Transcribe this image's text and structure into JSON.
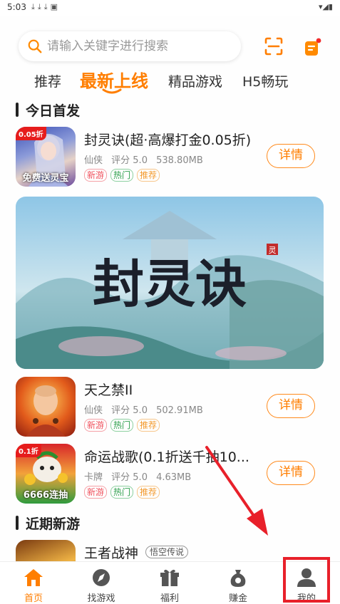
{
  "status_bar": {
    "time": "5:03"
  },
  "search": {
    "placeholder": "请输入关键字进行搜索"
  },
  "tabs": [
    {
      "label": "推荐",
      "active": false
    },
    {
      "label": "最新上线",
      "active": true
    },
    {
      "label": "精品游戏",
      "active": false
    },
    {
      "label": "H5畅玩",
      "active": false
    }
  ],
  "sections": {
    "today": "今日首发",
    "recent": "近期新游"
  },
  "games": [
    {
      "title": "封灵诀(超·高爆打金0.05折)",
      "category": "仙侠",
      "rating": "评分 5.0",
      "size": "538.80MB",
      "tags": [
        "新游",
        "热门",
        "推荐"
      ],
      "button": "详情",
      "icon_badge": "0.05折",
      "icon_text": "免费送灵宝"
    },
    {
      "title": "天之禁II",
      "category": "仙侠",
      "rating": "评分 5.0",
      "size": "502.91MB",
      "tags": [
        "新游",
        "热门",
        "推荐"
      ],
      "button": "详情"
    },
    {
      "title": "命运战歌(0.1折送千抽10...",
      "category": "卡牌",
      "rating": "评分 5.0",
      "size": "4.63MB",
      "tags": [
        "新游",
        "热门",
        "推荐"
      ],
      "button": "详情",
      "icon_badge": "0.1折",
      "icon_text": "6666连抽"
    }
  ],
  "banner": {
    "title": "封灵诀",
    "seal": "灵"
  },
  "recent_game": {
    "title": "王者战神",
    "tag": "悟空传说"
  },
  "bottom_nav": [
    {
      "label": "首页",
      "active": true
    },
    {
      "label": "找游戏",
      "active": false
    },
    {
      "label": "福利",
      "active": false
    },
    {
      "label": "赚金",
      "active": false
    },
    {
      "label": "我的",
      "active": false
    }
  ],
  "colors": {
    "accent": "#ff7e00",
    "annotation_red": "#e8202a"
  }
}
